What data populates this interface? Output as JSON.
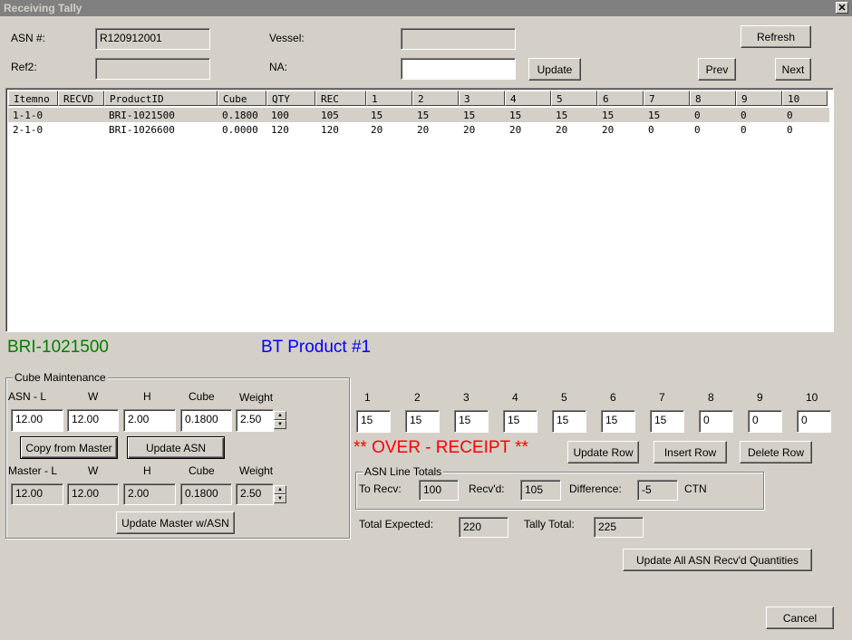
{
  "window": {
    "title": "Receiving Tally",
    "close": "✕"
  },
  "header": {
    "asn_label": "ASN #:",
    "asn_value": "R120912001",
    "vessel_label": "Vessel:",
    "vessel_value": "",
    "ref2_label": "Ref2:",
    "ref2_value": "",
    "na_label": "NA:",
    "na_value": "",
    "refresh": "Refresh",
    "update": "Update",
    "prev": "Prev",
    "next": "Next"
  },
  "grid": {
    "columns": [
      "Itemno",
      "RECVD",
      "ProductID",
      "Cube",
      "QTY",
      "REC",
      "1",
      "2",
      "3",
      "4",
      "5",
      "6",
      "7",
      "8",
      "9",
      "10"
    ],
    "rows": [
      [
        "1-1-0",
        "",
        "BRI-1021500",
        "0.1800",
        "100",
        "105",
        "15",
        "15",
        "15",
        "15",
        "15",
        "15",
        "15",
        "0",
        "0",
        "0"
      ],
      [
        "2-1-0",
        "",
        "BRI-1026600",
        "0.0000",
        "120",
        "120",
        "20",
        "20",
        "20",
        "20",
        "20",
        "20",
        "0",
        "0",
        "0",
        "0"
      ]
    ]
  },
  "product": {
    "id": "BRI-1021500",
    "name": "BT Product #1"
  },
  "cube": {
    "legend": "Cube Maintenance",
    "asn_l_label": "ASN - L",
    "w_label": "W",
    "h_label": "H",
    "cube_label": "Cube",
    "weight_label": "Weight",
    "asn_l": "12.00",
    "asn_w": "12.00",
    "asn_h": "2.00",
    "asn_cube": "0.1800",
    "asn_weight": "2.50",
    "copy_from_master": "Copy from Master",
    "update_asn": "Update ASN",
    "master_l_label": "Master - L",
    "master_l": "12.00",
    "master_w": "12.00",
    "master_h": "2.00",
    "master_cube": "0.1800",
    "master_weight": "2.50",
    "update_master": "Update Master w/ASN"
  },
  "tally": {
    "labels": [
      "1",
      "2",
      "3",
      "4",
      "5",
      "6",
      "7",
      "8",
      "9",
      "10"
    ],
    "values": [
      "15",
      "15",
      "15",
      "15",
      "15",
      "15",
      "15",
      "0",
      "0",
      "0"
    ],
    "over_receipt": "** OVER - RECEIPT **",
    "update_row": "Update Row",
    "insert_row": "Insert Row",
    "delete_row": "Delete Row"
  },
  "totals": {
    "legend": "ASN Line Totals",
    "to_recv_label": "To Recv:",
    "to_recv": "100",
    "recvd_label": "Recv'd:",
    "recvd": "105",
    "diff_label": "Difference:",
    "diff": "-5",
    "unit": "CTN",
    "total_expected_label": "Total Expected:",
    "total_expected": "220",
    "tally_total_label": "Tally Total:",
    "tally_total": "225",
    "update_all": "Update All ASN Recv'd Quantities"
  },
  "footer": {
    "cancel": "Cancel"
  },
  "colors": {
    "product_id": "#008000",
    "product_name": "#0000ff",
    "over_receipt": "#ff0000"
  }
}
